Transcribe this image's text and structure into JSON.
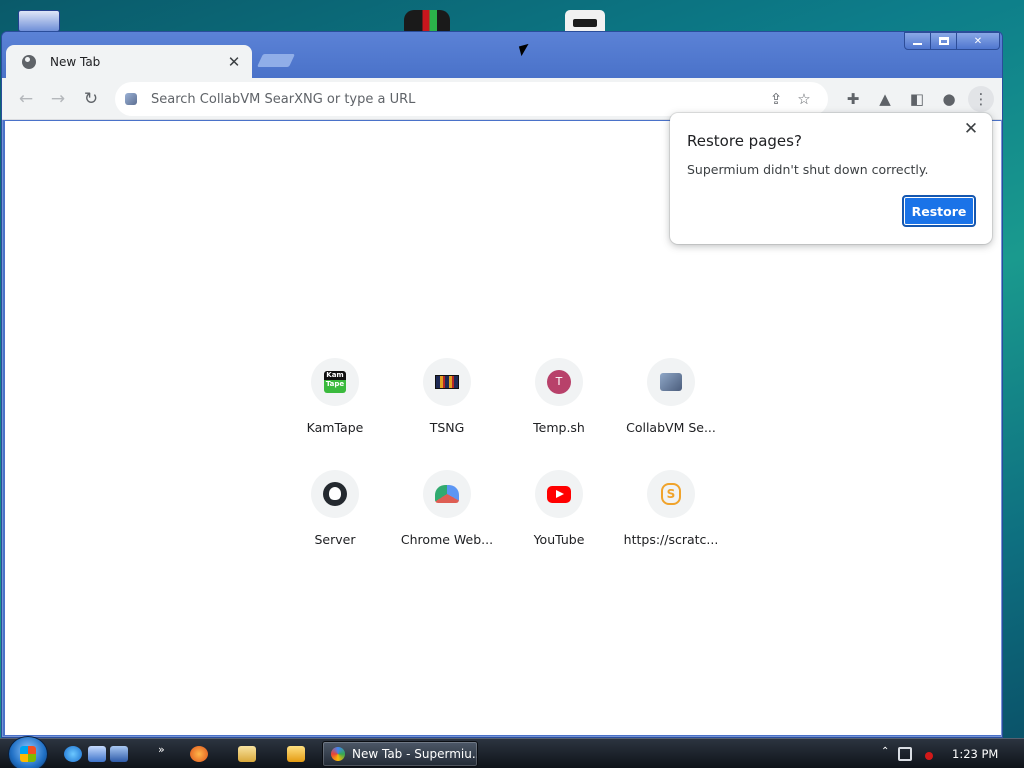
{
  "browser": {
    "tab_title": "New Tab",
    "omnibox_placeholder": "Search CollabVM SearXNG or type a URL"
  },
  "shortcuts": [
    {
      "label": "KamTape",
      "icon": "kamtape-icon",
      "glyph": "Kam Tape"
    },
    {
      "label": "TSNG",
      "icon": "tsng-icon",
      "glyph": ""
    },
    {
      "label": "Temp.sh",
      "icon": "letter-t-icon",
      "glyph": "T"
    },
    {
      "label": "CollabVM Se...",
      "icon": "collabvm-icon",
      "glyph": ""
    },
    {
      "label": "Server",
      "icon": "github-icon",
      "glyph": ""
    },
    {
      "label": "Chrome Web...",
      "icon": "chrome-web-store-icon",
      "glyph": ""
    },
    {
      "label": "YouTube",
      "icon": "youtube-icon",
      "glyph": ""
    },
    {
      "label": "https://scratc...",
      "icon": "scratch-icon",
      "glyph": "S"
    }
  ],
  "restore_popup": {
    "title": "Restore pages?",
    "message": "Supermium didn't shut down correctly.",
    "button": "Restore",
    "button_color": "#1a73e8"
  },
  "taskbar": {
    "active_window_label": "New Tab - Supermiu...",
    "clock": "1:23 PM"
  }
}
